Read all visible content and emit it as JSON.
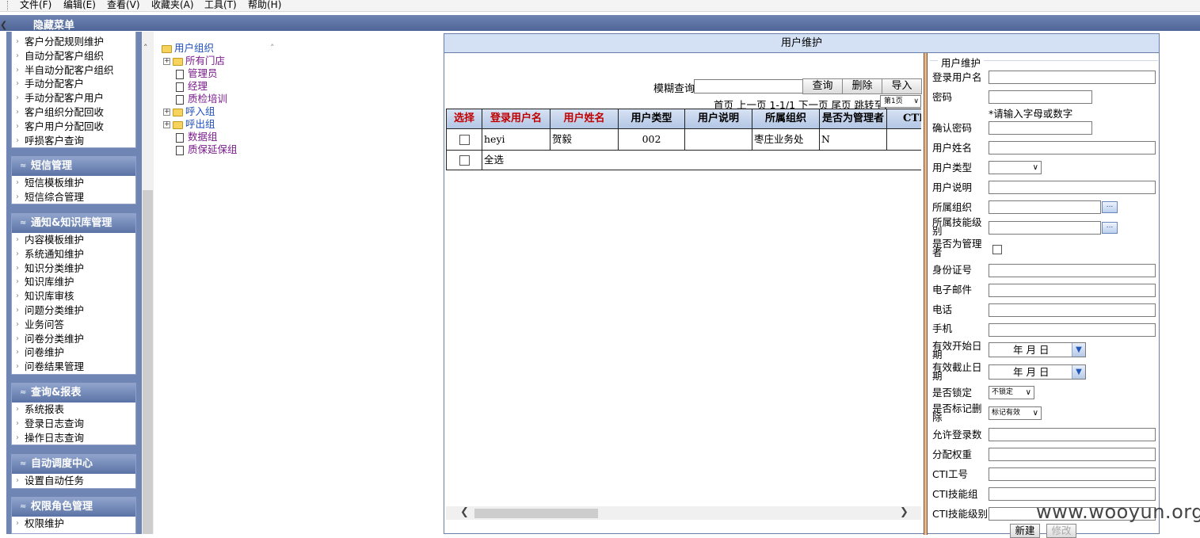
{
  "menubar": {
    "items": [
      "文件(F)",
      "编辑(E)",
      "查看(V)",
      "收藏夹(A)",
      "工具(T)",
      "帮助(H)"
    ]
  },
  "topbar": {
    "title": "隐藏菜单"
  },
  "nav": {
    "panel1_items": [
      "客户分配规则维护",
      "自动分配客户组织",
      "半自动分配客户组织",
      "手动分配客户",
      "手动分配客户用户",
      "客户组织分配回收",
      "客户用户分配回收",
      "呼损客户查询"
    ],
    "panels": [
      {
        "title": "短信管理",
        "items": [
          "短信模板维护",
          "短信综合管理"
        ]
      },
      {
        "title": "通知&知识库管理",
        "items": [
          "内容模板维护",
          "系统通知维护",
          "知识分类维护",
          "知识库维护",
          "知识库审核",
          "问题分类维护",
          "业务问答",
          "问卷分类维护",
          "问卷维护",
          "问卷结果管理"
        ]
      },
      {
        "title": "查询&报表",
        "items": [
          "系统报表",
          "登录日志查询",
          "操作日志查询"
        ]
      },
      {
        "title": "自动调度中心",
        "items": [
          "设置自动任务"
        ]
      },
      {
        "title": "权限角色管理",
        "items": [
          "权限维护"
        ]
      }
    ]
  },
  "tree": {
    "root": "用户组织",
    "nodes": [
      "所有门店",
      "管理员",
      "经理",
      "质检培训",
      "呼入组",
      "呼出组",
      "数据组",
      "质保延保组"
    ]
  },
  "main": {
    "title": "用户维护",
    "search_label": "模糊查询",
    "search_value": "",
    "buttons": {
      "query": "查询",
      "delete": "删除",
      "import": "导入"
    },
    "pager_text": "首页 上一页 1-1/1 下一页 尾页 跳转至:",
    "page_select": "第1页",
    "columns": [
      "选择",
      "登录用户名",
      "用户姓名",
      "用户类型",
      "用户说明",
      "所属组织",
      "是否为管理者",
      "CTI"
    ],
    "rows": [
      {
        "login": "heyi",
        "name": "贺毅",
        "type": "002",
        "desc": "",
        "org": "枣庄业务处",
        "manager": "N",
        "cti": ""
      }
    ],
    "select_all": "全选"
  },
  "form": {
    "legend": "用户维护",
    "labels": {
      "login": "登录用户名",
      "password": "密码",
      "password_hint": "*请输入字母或数字",
      "confirm": "确认密码",
      "name": "用户姓名",
      "type": "用户类型",
      "desc": "用户说明",
      "org": "所属组织",
      "skill": "所属技能级别",
      "is_manager": "是否为管理者",
      "id_no": "身份证号",
      "email": "电子邮件",
      "phone": "电话",
      "mobile": "手机",
      "start": "有效开始日期",
      "end": "有效截止日期",
      "locked": "是否锁定",
      "deleted": "是否标记删除",
      "login_count": "允许登录数",
      "weight": "分配权重",
      "cti_no": "CTI工号",
      "cti_group": "CTI技能组",
      "cti_level": "CTI技能级别"
    },
    "dot_button": "...",
    "date_text": "年 月 日",
    "locked_value": "不锁定",
    "deleted_value": "标记有效",
    "buttons": {
      "new": "新建",
      "modify": "修改"
    }
  },
  "watermark": "www.wooyun.org"
}
